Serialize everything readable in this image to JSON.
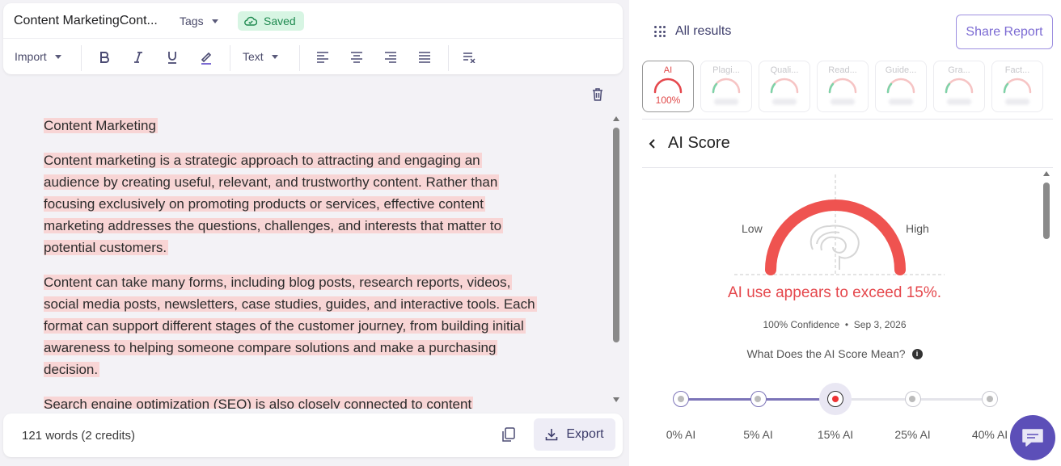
{
  "editor_toolbar": {
    "doc_title": "Content MarketingCont...",
    "tags_label": "Tags",
    "saved_label": "Saved",
    "import_label": "Import",
    "text_style_label": "Text"
  },
  "editor": {
    "paragraphs": [
      "Content Marketing",
      "Content marketing is a strategic approach to attracting and engaging an audience by creating useful, relevant, and trustworthy content. Rather than focusing exclusively on promoting products or services, effective content marketing addresses the questions, challenges, and interests that matter to potential customers.",
      "Content can take many forms, including blog posts, research reports, videos, social media posts, newsletters, case studies, guides, and interactive tools. Each format can support different stages of the customer journey, from building initial awareness to helping someone compare solutions and make a purchasing decision.",
      "Search engine optimization (SEO) is also closely connected to content"
    ],
    "highlight_color": "#f8d5d5"
  },
  "footer": {
    "word_count": "121 words (2 credits)",
    "export_label": "Export"
  },
  "results": {
    "all_results_label": "All results",
    "share_label": "Share Report",
    "cards": [
      {
        "label": "AI",
        "value": "100%",
        "active": true
      },
      {
        "label": "Plagi...",
        "value": "",
        "active": false
      },
      {
        "label": "Quali...",
        "value": "",
        "active": false
      },
      {
        "label": "Read...",
        "value": "",
        "active": false
      },
      {
        "label": "Guide...",
        "value": "",
        "active": false
      },
      {
        "label": "Gra...",
        "value": "",
        "active": false
      },
      {
        "label": "Fact...",
        "value": "",
        "active": false
      }
    ],
    "section_title": "AI Score",
    "gauge": {
      "low_label": "Low",
      "high_label": "High",
      "level": 1.0,
      "color": "#ef5350"
    },
    "verdict": "AI use appears to exceed 15%.",
    "confidence": "100% Confidence",
    "date": "Sep 3, 2026",
    "meaning_question": "What Does the AI Score Mean?",
    "scale_stops": [
      {
        "label": "0% AI",
        "state": "done"
      },
      {
        "label": "5% AI",
        "state": "done"
      },
      {
        "label": "15% AI",
        "state": "current"
      },
      {
        "label": "25% AI",
        "state": "todo"
      },
      {
        "label": "40% AI",
        "state": "todo"
      }
    ]
  },
  "colors": {
    "accent": "#7c6bd3",
    "danger": "#e5484d",
    "saved_bg": "#d7f5e3",
    "saved_text": "#1f8a50"
  }
}
